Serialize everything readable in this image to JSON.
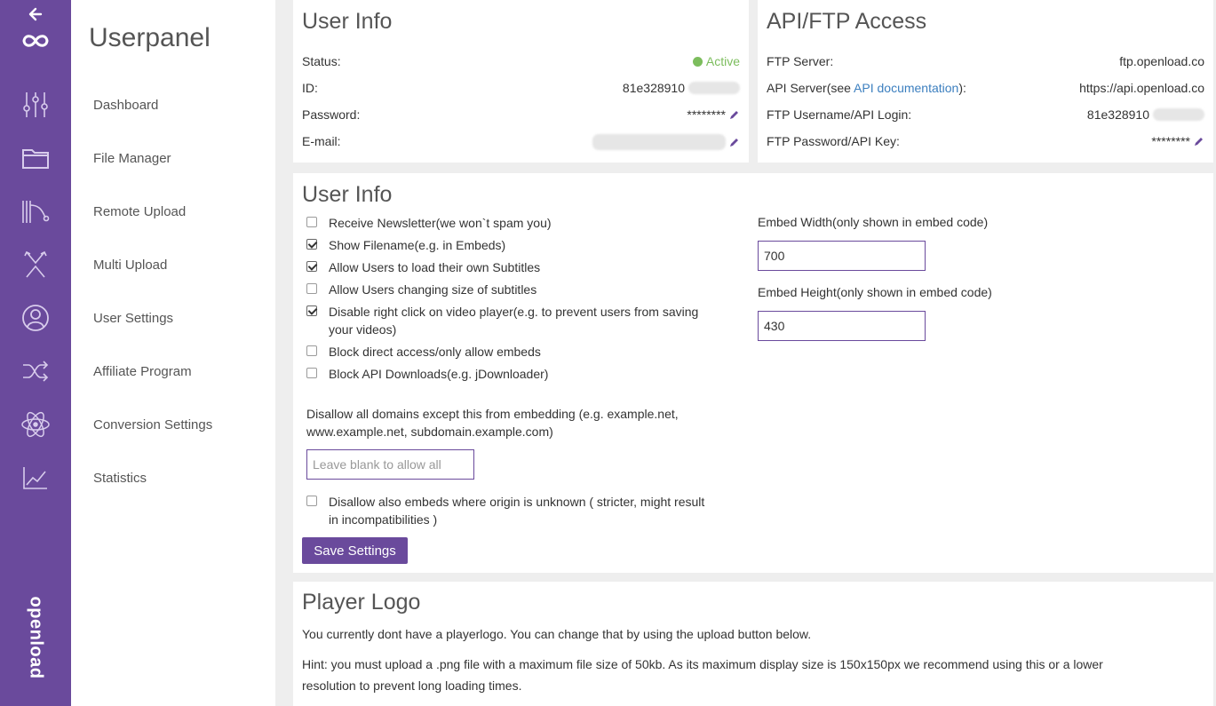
{
  "nav": {
    "title": "Userpanel",
    "items": [
      "Dashboard",
      "File Manager",
      "Remote Upload",
      "Multi Upload",
      "User Settings",
      "Affiliate Program",
      "Conversion Settings",
      "Statistics"
    ]
  },
  "brand": {
    "name": "openload"
  },
  "rail_icons": [
    "back-arrow-icon",
    "infinity-logo-icon",
    "sliders-icon",
    "folder-icon",
    "remote-upload-icon",
    "multi-upload-icon",
    "user-icon",
    "shuffle-icon",
    "atom-icon",
    "chart-icon"
  ],
  "user_info": {
    "title": "User Info",
    "status_label": "Status:",
    "status_value": "Active",
    "id_label": "ID:",
    "id_value": "81e328910",
    "password_label": "Password:",
    "password_value": "********",
    "email_label": "E-mail:"
  },
  "api": {
    "title": "API/FTP Access",
    "ftp_server_label": "FTP Server:",
    "ftp_server_value": "ftp.openload.co",
    "api_server_label_pre": "API Server(see ",
    "api_server_link": "API documentation",
    "api_server_label_post": "):",
    "api_server_value": "https://api.openload.co",
    "ftp_user_label": "FTP Username/API Login:",
    "ftp_user_value": "81e328910",
    "ftp_pass_label": "FTP Password/API Key:",
    "ftp_pass_value": "********"
  },
  "settings": {
    "title": "User Info",
    "checkboxes": [
      {
        "label": "Receive Newsletter(we won`t spam you)",
        "checked": false
      },
      {
        "label": "Show Filename(e.g. in Embeds)",
        "checked": true
      },
      {
        "label": "Allow Users to load their own Subtitles",
        "checked": true
      },
      {
        "label": "Allow Users changing size of subtitles",
        "checked": false
      },
      {
        "label": "Disable right click on video player(e.g. to prevent users from saving",
        "label2": "your videos)",
        "checked": true
      },
      {
        "label": "Block direct access/only allow embeds",
        "checked": false
      },
      {
        "label": "Block API Downloads(e.g. jDownloader)",
        "checked": false
      }
    ],
    "domain_text_1": "Disallow all domains except this from embedding (e.g. example.net,",
    "domain_text_2": "www.example.net, subdomain.example.com)",
    "domain_placeholder": "Leave blank to allow all",
    "unknown_origin_1": "Disallow also embeds where origin is unknown ( stricter, might result",
    "unknown_origin_2": "in incompatibilities )",
    "unknown_origin_checked": false,
    "save_label": "Save Settings",
    "embed_width_label": "Embed Width(only shown in embed code)",
    "embed_width_value": "700",
    "embed_height_label": "Embed Height(only shown in embed code)",
    "embed_height_value": "430"
  },
  "player_logo": {
    "title": "Player Logo",
    "text1": "You currently dont have a playerlogo. You can change that by using the upload button below.",
    "text2": "Hint: you must upload a .png file with a maximum file size of 50kb. As its maximum display size is 150x150px we recommend using this or a lower",
    "text3": "resolution to prevent long loading times."
  },
  "colors": {
    "accent": "#6a4a9c",
    "active": "#7cbd5d",
    "link": "#3c7fbf"
  }
}
